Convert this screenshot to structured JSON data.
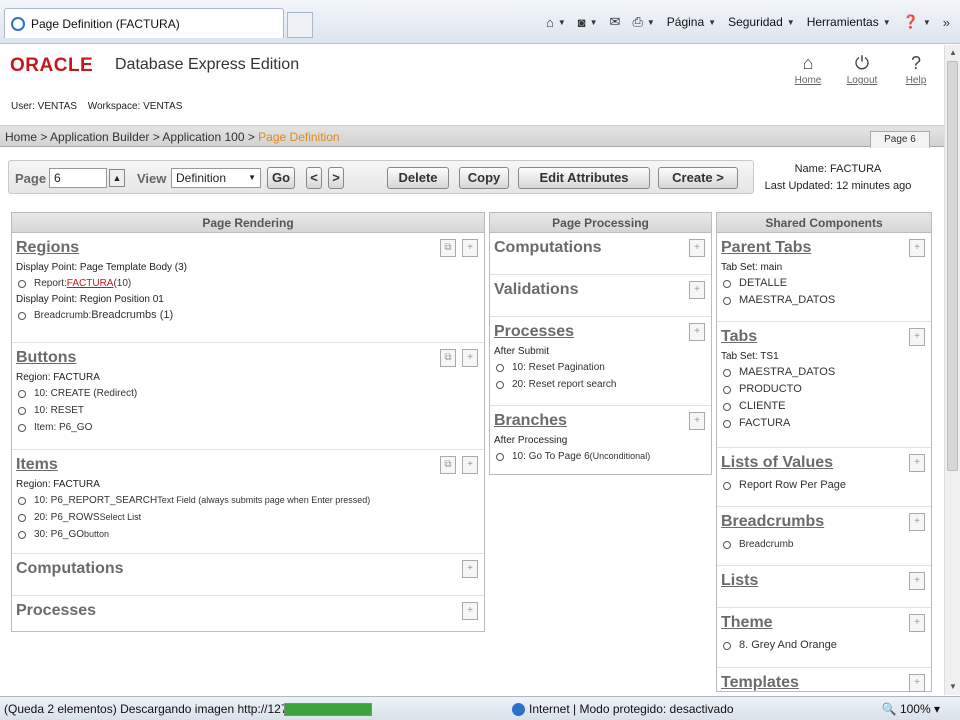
{
  "browser": {
    "tab_title": "Page Definition (FACTURA)",
    "menu": [
      "Página",
      "Seguridad",
      "Herramientas"
    ]
  },
  "header": {
    "logo": "ORACLE",
    "product": "Database Express Edition",
    "user_label": "User: VENTAS",
    "workspace_label": "Workspace: VENTAS",
    "links": [
      {
        "label": "Home",
        "icon": "home-icon"
      },
      {
        "label": "Logout",
        "icon": "power-icon"
      },
      {
        "label": "Help",
        "icon": "help-icon"
      }
    ]
  },
  "breadcrumb": {
    "path": "Home > Application Builder > Application 100 > ",
    "current": "Page Definition",
    "page_tab": "Page 6"
  },
  "controls": {
    "page_label": "Page",
    "page_value": "6",
    "view_label": "View",
    "view_value": "Definition",
    "go": "Go",
    "prev": "<",
    "next": ">",
    "delete": "Delete",
    "copy": "Copy",
    "edit_attributes": "Edit Attributes",
    "create": "Create >"
  },
  "page_meta": {
    "name": "Name: FACTURA",
    "updated": "Last Updated: 12 minutes ago"
  },
  "rendering": {
    "title": "Page Rendering",
    "regions": {
      "title": "Regions",
      "display1": "Display Point: Page Template Body (3)",
      "report_prefix": "Report: ",
      "report_link": "FACTURA",
      "report_suffix": " (10)",
      "display2": "Display Point: Region Position 01",
      "breadcrumb_prefix": "Breadcrumb: ",
      "breadcrumb_value": "Breadcrumbs (1)"
    },
    "buttons": {
      "title": "Buttons",
      "region": "Region: FACTURA",
      "items": [
        "10: CREATE (Redirect)",
        "10: RESET",
        "Item: P6_GO"
      ]
    },
    "items": {
      "title": "Items",
      "region": "Region: FACTURA",
      "list": [
        {
          "main": "10: P6_REPORT_SEARCH",
          "detail": " Text Field (always submits page when Enter pressed)"
        },
        {
          "main": "20: P6_ROWS",
          "detail": " Select List"
        },
        {
          "main": "30: P6_GO",
          "detail": " button"
        }
      ]
    },
    "computations": "Computations",
    "processes": "Processes"
  },
  "processing": {
    "title": "Page Processing",
    "computations": "Computations",
    "validations": "Validations",
    "processes": {
      "title": "Processes",
      "sub": "After Submit",
      "items": [
        "10: Reset Pagination",
        "20: Reset report search"
      ]
    },
    "branches": {
      "title": "Branches",
      "sub": "After Processing",
      "item_main": "10: Go To Page  6",
      "item_detail": " (Unconditional)"
    }
  },
  "shared": {
    "title": "Shared Components",
    "parent_tabs": {
      "title": "Parent Tabs",
      "sub": "Tab Set: main",
      "items": [
        "DETALLE",
        "MAESTRA_DATOS"
      ]
    },
    "tabs": {
      "title": "Tabs",
      "sub": "Tab Set: TS1",
      "items": [
        "MAESTRA_DATOS",
        "PRODUCTO",
        "CLIENTE",
        "FACTURA"
      ]
    },
    "lov": {
      "title": "Lists of Values",
      "items": [
        "Report Row Per Page"
      ]
    },
    "breadcrumbs": {
      "title": "Breadcrumbs",
      "items": [
        "Breadcrumb"
      ]
    },
    "lists": {
      "title": "Lists"
    },
    "theme": {
      "title": "Theme",
      "items": [
        "8. Grey And Orange"
      ]
    },
    "templates": {
      "title": "Templates"
    }
  },
  "status": {
    "text": "(Queda 2 elementos) Descargando imagen http://127.0.0",
    "progress": 1.0,
    "zone": "Internet | Modo protegido: desactivado",
    "zoom": "100%"
  }
}
